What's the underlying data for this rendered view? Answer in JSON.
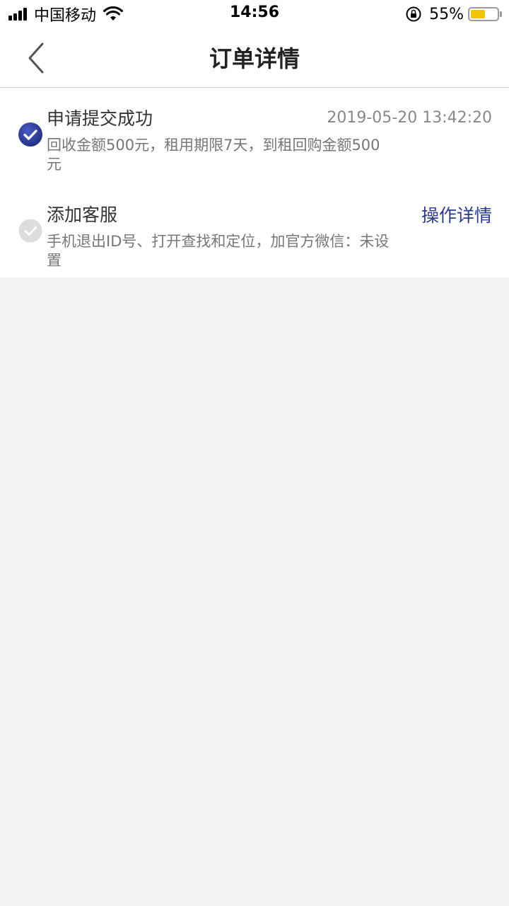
{
  "status_bar": {
    "carrier": "中国移动",
    "time": "14:56",
    "battery_percent": "55%",
    "battery_level": 0.55,
    "battery_color": "#f5c400"
  },
  "nav": {
    "back_icon": "chevron-left-icon",
    "title": "订单详情"
  },
  "steps": [
    {
      "title": "申请提交成功",
      "time": "2019-05-20 13:42:20",
      "desc": "回收金额500元，租用期限7天，到租回购金额500元",
      "status": "completed",
      "icon": "check-circle-icon",
      "icon_color": "#2b3a93"
    },
    {
      "title": "添加客服",
      "action": "操作详情",
      "desc": "手机退出ID号、打开查找和定位，加官方微信：未设置",
      "status": "pending",
      "icon": "check-circle-icon",
      "icon_color": "#d9d9d9"
    }
  ],
  "colors": {
    "accent": "#2a3b8f",
    "background": "#f2f2f2"
  }
}
